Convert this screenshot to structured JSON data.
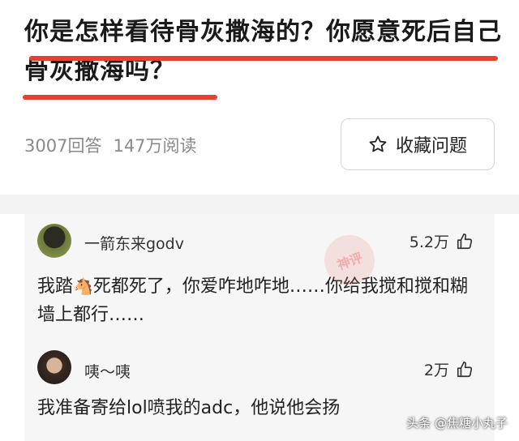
{
  "question": {
    "title": "你是怎样看待骨灰撒海的？你愿意死后自己骨灰撒海吗？",
    "answers": "3007回答",
    "reads": "147万阅读",
    "favorite_label": "收藏问题"
  },
  "comments": [
    {
      "author": "一箭东来godv",
      "likes": "5.2万",
      "text_before": "我踏",
      "emoji": "🐴",
      "text_after": "死都死了，你爱咋地咋地……你给我搅和搅和糊墙上都行……"
    },
    {
      "author": "咦～咦",
      "likes": "2万",
      "text": "我准备寄给lol喷我的adc，他说他会扬"
    }
  ],
  "watermark": "神评",
  "source": "头条 @焦糖小丸子",
  "colors": {
    "underline": "#e8402f",
    "muted": "#8a8a8a"
  }
}
